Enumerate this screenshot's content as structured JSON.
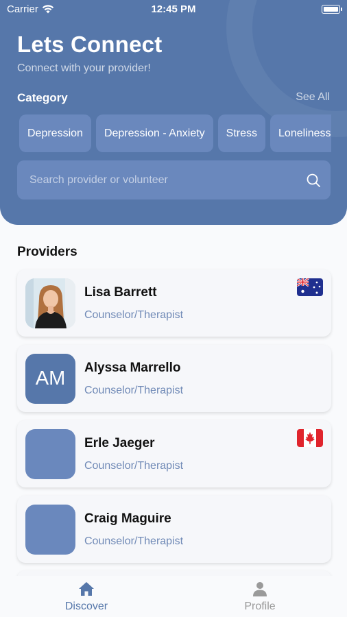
{
  "status_bar": {
    "carrier": "Carrier",
    "time": "12:45 PM"
  },
  "header": {
    "title": "Lets Connect",
    "subtitle": "Connect with your provider!",
    "category_label": "Category",
    "see_all": "See All",
    "categories": [
      "Depression",
      "Depression - Anxiety",
      "Stress",
      "Loneliness"
    ],
    "search_placeholder": "Search provider or volunteer"
  },
  "providers": {
    "title": "Providers",
    "items": [
      {
        "name": "Lisa Barrett",
        "role": "Counselor/Therapist",
        "avatar": "photo",
        "flag": "australia-flag"
      },
      {
        "name": "Alyssa Marrello",
        "role": "Counselor/Therapist",
        "avatar_initials": "AM"
      },
      {
        "name": "Erle Jaeger",
        "role": "Counselor/Therapist",
        "avatar": "blank",
        "flag": "canada-flag"
      },
      {
        "name": "Craig Maguire",
        "role": "Counselor/Therapist",
        "avatar": "blank"
      }
    ]
  },
  "tabbar": {
    "discover": "Discover",
    "profile": "Profile",
    "active": "discover"
  },
  "colors": {
    "primary": "#5677aa",
    "chip": "#6a88bd",
    "role_text": "#6f89b6",
    "inactive_tab": "#9a9a9a"
  }
}
